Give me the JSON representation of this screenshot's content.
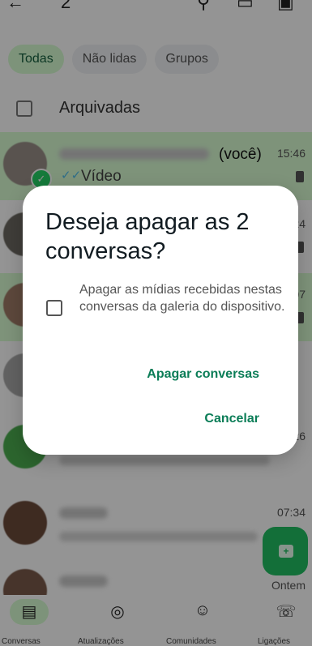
{
  "topbar": {
    "count": "2"
  },
  "filters": [
    {
      "label": "Todas"
    },
    {
      "label": "Não lidas"
    },
    {
      "label": "Grupos"
    }
  ],
  "archived": {
    "label": "Arquivadas"
  },
  "chats": [
    {
      "you_label": "(você)",
      "time": "15:46",
      "preview": "Vídeo",
      "selected": true
    },
    {
      "time": ":24",
      "selected": false
    },
    {
      "time": ":07",
      "selected": true
    },
    {
      "time": "",
      "selected": false
    },
    {
      "time": ":26",
      "selected": false
    },
    {
      "time": "07:34",
      "selected": false
    },
    {
      "time": "Ontem",
      "selected": false
    }
  ],
  "dialog": {
    "title": "Deseja apagar as 2 conversas?",
    "checkbox_label": "Apagar as mídias recebidas nestas conversas da galeria do dispositivo.",
    "confirm": "Apagar conversas",
    "cancel": "Cancelar"
  },
  "bottom_nav": {
    "labels": [
      "Conversas",
      "Atualizações",
      "Comunidades",
      "Ligações"
    ]
  },
  "colors": {
    "accent": "#0b7d57",
    "selected_row": "#d9fdd3",
    "fab": "#21c063"
  }
}
